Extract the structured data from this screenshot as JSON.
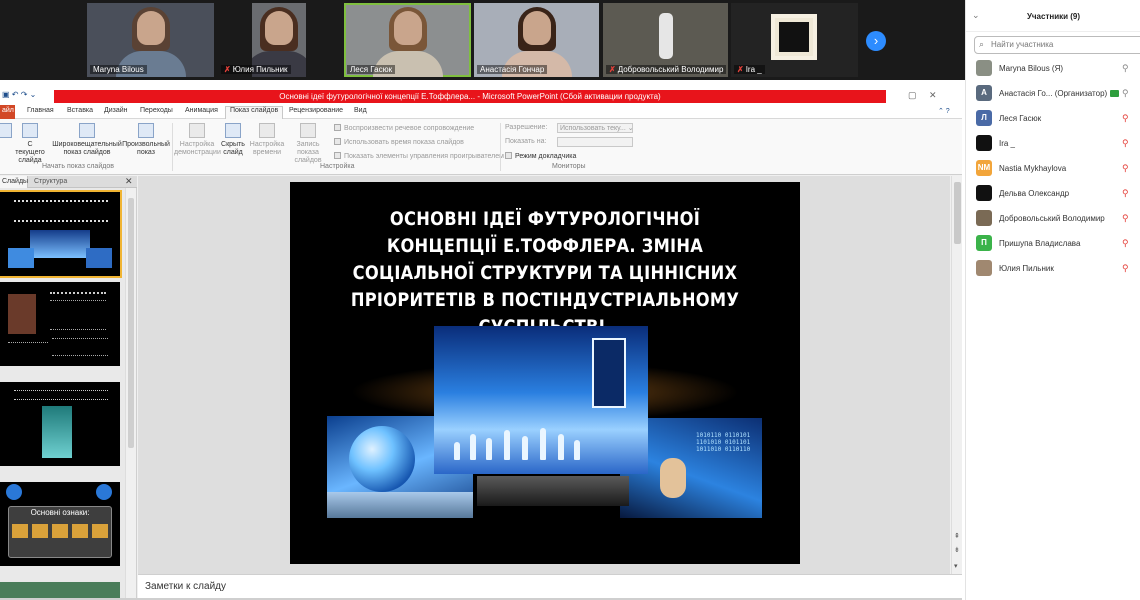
{
  "video_strip": {
    "tiles": [
      {
        "name": "Maryna Bilous",
        "muted": false
      },
      {
        "name": "Юлия Пильник",
        "muted": true
      },
      {
        "name": "Леся Гасюк",
        "muted": false
      },
      {
        "name": "Анастасія Гончар",
        "muted": false
      },
      {
        "name": "Добровольський Володимир",
        "muted": true
      },
      {
        "name": "Ira _",
        "muted": true
      }
    ],
    "mute_glyph": "✗",
    "next_glyph": "›"
  },
  "participants": {
    "title": "Участники (9)",
    "search_placeholder": "Найти участника",
    "list": [
      {
        "name": "Maryna Bilous (Я)",
        "avatar": "",
        "avatar_color": "#8a8f84",
        "video": false,
        "mic": "on"
      },
      {
        "name": "Анастасія Го... (Организатор)",
        "avatar": "А",
        "avatar_color": "#5a6a7e",
        "video": true,
        "mic": "on"
      },
      {
        "name": "Леся Гасюк",
        "avatar": "Л",
        "avatar_color": "#4a6aa6",
        "video": false,
        "mic": "off"
      },
      {
        "name": "Ira _",
        "avatar": "",
        "avatar_color": "#111111",
        "video": false,
        "mic": "off"
      },
      {
        "name": "Nastia Mykhaylova",
        "avatar": "NM",
        "avatar_color": "#f2a53a",
        "video": false,
        "mic": "off"
      },
      {
        "name": "Дельва Олександр",
        "avatar": "",
        "avatar_color": "#111111",
        "video": false,
        "mic": "off"
      },
      {
        "name": "Добровольський Володимир",
        "avatar": "",
        "avatar_color": "#7a6a55",
        "video": false,
        "mic": "off"
      },
      {
        "name": "Пришупа Владислава",
        "avatar": "П",
        "avatar_color": "#3bb34a",
        "video": false,
        "mic": "off"
      },
      {
        "name": "Юлия Пильник",
        "avatar": "",
        "avatar_color": "#a08870",
        "video": false,
        "mic": "off"
      }
    ]
  },
  "powerpoint": {
    "title": "Основні ідеї футурологічної концепції Е.Тоффлера... - Microsoft PowerPoint (Сбой активации продукта)",
    "tabs": [
      "Главная",
      "Вставка",
      "Дизайн",
      "Переходы",
      "Анимация",
      "Показ слайдов",
      "Рецензирование",
      "Вид"
    ],
    "ribbon": {
      "from_current": "С текущего слайда",
      "broadcast": "Широковещательный показ слайдов",
      "custom": "Произвольный показ",
      "group_start": "Начать показ слайдов",
      "setup": "Настройка демонстрации",
      "hide": "Скрыть слайд",
      "rehearse": "Настройка времени",
      "record": "Запись показа слайдов",
      "chk_narrations": "Воспроизвести речевое сопровождение",
      "chk_timings": "Использовать время показа слайдов",
      "chk_controls": "Показать элементы управления проигрывателем",
      "group_setup": "Настройка",
      "resolution_label": "Разрешение:",
      "resolution_value": "Использовать теку...",
      "show_on_label": "Показать на:",
      "presenter_view": "Режим докладчика",
      "group_monitors": "Мониторы"
    },
    "slide_panel": {
      "tab_slides": "Слайды",
      "tab_outline": "Структура",
      "thumb4_title": "Основні ознаки:"
    },
    "slide": {
      "title": "ОСНОВНІ ІДЕЇ ФУТУРОЛОГІЧНОЇ КОНЦЕПЦІЇ Е.ТОФФЛЕРА. ЗМІНА СОЦІАЛЬНОЇ СТРУКТУРИ ТА ЦІННІСНИХ ПРІОРИТЕТІВ В ПОСТІНДУСТРІАЛЬНОМУ СУСПІЛЬСТВІ.",
      "binary": "1010110 0110101 1101010 0101101 1011010 0110110"
    },
    "notes_placeholder": "Заметки к слайду"
  },
  "colors": {
    "zoom_blue": "#2d8cff",
    "ppt_red": "#e8141b",
    "mute_red": "#e5413a"
  }
}
